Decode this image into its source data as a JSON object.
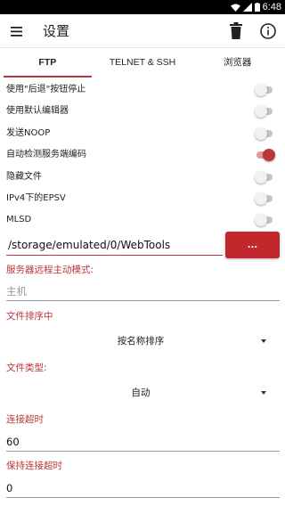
{
  "status_bar": {
    "time": "6:48"
  },
  "app_bar": {
    "title": "设置"
  },
  "tabs": [
    {
      "label": "FTP",
      "active": true
    },
    {
      "label": "TELNET & SSH",
      "active": false
    },
    {
      "label": "浏览器",
      "active": false
    }
  ],
  "switches": [
    {
      "label": "使用\"后退\"按钮停止",
      "on": false
    },
    {
      "label": "使用默认编辑器",
      "on": false
    },
    {
      "label": "发送NOOP",
      "on": false
    },
    {
      "label": "自动检测服务端编码",
      "on": true
    },
    {
      "label": "隐藏文件",
      "on": false
    },
    {
      "label": "IPv4下的EPSV",
      "on": false
    },
    {
      "label": "MLSD",
      "on": false
    }
  ],
  "path": {
    "value": "/storage/emulated/0/WebTools",
    "button_label": "..."
  },
  "remote_active_mode": {
    "label": "服务器远程主动模式:",
    "placeholder": "主机",
    "value": ""
  },
  "file_sort": {
    "label": "文件排序中",
    "selected": "按名称排序"
  },
  "file_type": {
    "label": "文件类型:",
    "selected": "自动"
  },
  "connect_timeout": {
    "label": "连接超时",
    "value": "60"
  },
  "keepalive_timeout": {
    "label": "保持连接超时",
    "value": "0"
  },
  "colors": {
    "accent": "#b9373a",
    "button": "#c0282d"
  }
}
